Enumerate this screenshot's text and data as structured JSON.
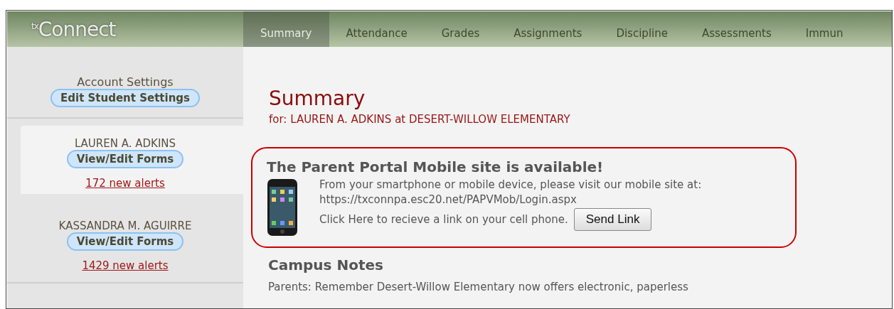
{
  "logo": "$^{tx}$Connect",
  "tabs": [
    {
      "label": "Summary",
      "selected": true
    },
    {
      "label": "Attendance",
      "selected": false
    },
    {
      "label": "Grades",
      "selected": false
    },
    {
      "label": "Assignments",
      "selected": false
    },
    {
      "label": "Discipline",
      "selected": false
    },
    {
      "label": "Assessments",
      "selected": false
    },
    {
      "label": "Immun",
      "selected": false
    }
  ],
  "sidebar": {
    "account_title": "Account Settings",
    "account_button": "Edit Student Settings",
    "students": [
      {
        "name": "LAUREN A. ADKINS",
        "button": "View/Edit Forms",
        "alerts": "172 new alerts",
        "selected": true
      },
      {
        "name": "KASSANDRA M. AGUIRRE",
        "button": "View/Edit Forms",
        "alerts": "1429 new alerts",
        "selected": false
      }
    ]
  },
  "main": {
    "title": "Summary",
    "subtitle": "for: LAUREN A. ADKINS at DESERT-WILLOW ELEMENTARY",
    "mobile_notice": {
      "heading": "The Parent Portal Mobile site is available!",
      "line_1": "From your smartphone or mobile device, please visit our mobile site at:",
      "line_2": "https://txconnpa.esc20.net/PAPVMob/Login.aspx",
      "line_3": "Click Here to recieve a link on your cell phone.",
      "button": "Send Link"
    },
    "campus_notes": {
      "heading": "Campus Notes",
      "text": "Parents: Remember Desert-Willow Elementary now offers electronic, paperless"
    }
  }
}
